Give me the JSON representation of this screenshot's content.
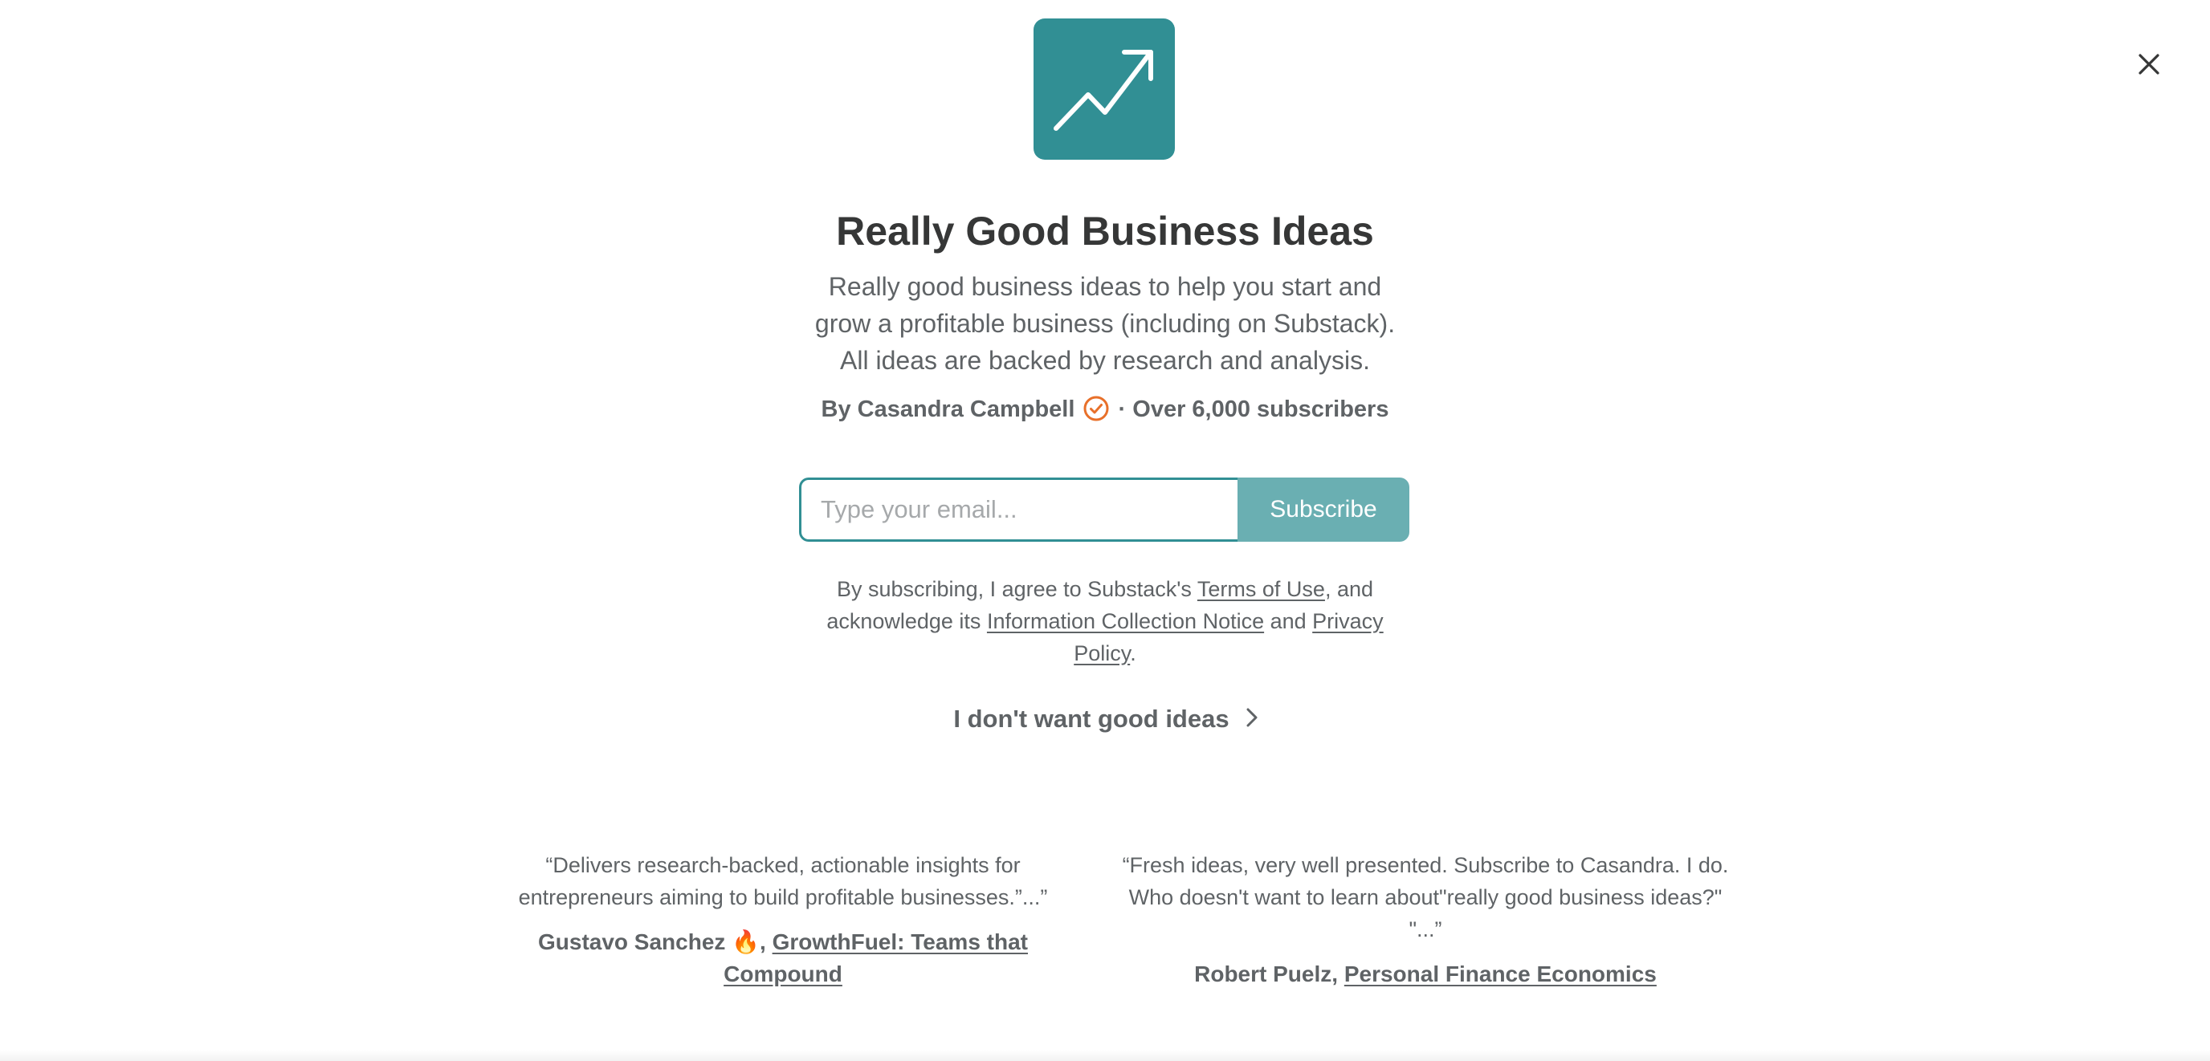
{
  "close": {
    "icon": "close-icon"
  },
  "logo": {
    "icon": "trending-up-icon",
    "background": "#318f94"
  },
  "publication": {
    "title": "Really Good Business Ideas",
    "description": "Really good business ideas to help you start and grow a profitable business (including on Substack). All ideas are backed by research and analysis.",
    "byline_prefix": "By Casandra Campbell",
    "byline_suffix": "· Over 6,000 subscribers",
    "verified_icon": "verified-check-icon",
    "verified_color": "#e8702a"
  },
  "form": {
    "email_placeholder": "Type your email...",
    "email_value": "",
    "subscribe_label": "Subscribe",
    "accent": "#6aafb2"
  },
  "legal": {
    "part1": "By subscribing, I agree to Substack's ",
    "terms": "Terms of Use",
    "part2": ", and acknowledge its ",
    "notice": "Information Collection Notice",
    "part3": " and ",
    "privacy": "Privacy Policy",
    "part4": "."
  },
  "skip": {
    "label": "I don't want good ideas",
    "icon": "chevron-right-icon"
  },
  "testimonials": [
    {
      "quote": "“Delivers research-backed, actionable insights for entrepreneurs aiming to build profitable businesses.”...”",
      "author": "Gustavo Sanchez 🔥, ",
      "publication": "GrowthFuel: Teams that Compound"
    },
    {
      "quote": "“Fresh ideas, very well presented. Subscribe to Casandra. I do. Who doesn't want to learn about\"really good business ideas?\" \"...”",
      "author": "Robert Puelz, ",
      "publication": "Personal Finance Economics"
    }
  ]
}
